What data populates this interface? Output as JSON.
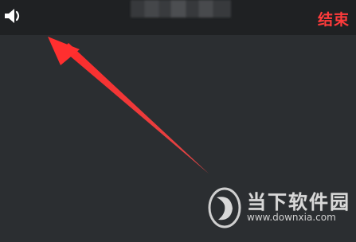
{
  "top_bar": {
    "end_call_label": "结束",
    "end_call_color": "#ff3b3b",
    "caller_name": "",
    "speaker_icon": "speaker-icon"
  },
  "annotation": {
    "arrow_color": "#ff3030"
  },
  "watermark": {
    "name": "当下软件园",
    "url": "www.downxia.com"
  }
}
